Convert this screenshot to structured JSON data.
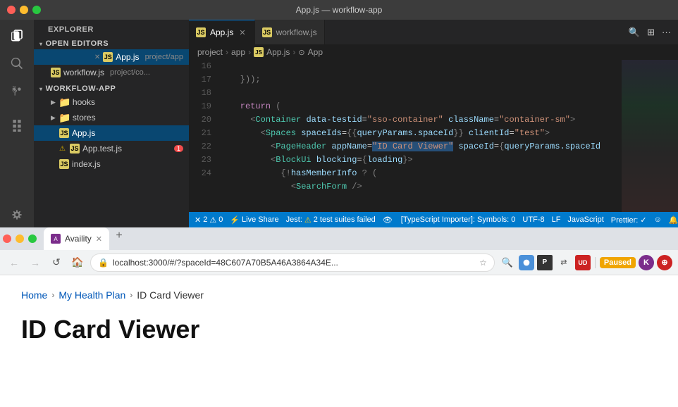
{
  "titlebar": {
    "title": "App.js — workflow-app"
  },
  "vscode": {
    "sidebar": {
      "header": "Explorer",
      "open_editors_label": "Open Editors",
      "workflow_app_label": "WORKFLOW-APP",
      "files": [
        {
          "name": "App.js",
          "sub": "project/app",
          "type": "js",
          "closeable": true
        },
        {
          "name": "workflow.js",
          "sub": "project/co...",
          "type": "js",
          "closeable": false
        }
      ],
      "tree": [
        {
          "name": "hooks",
          "type": "folder",
          "depth": 1
        },
        {
          "name": "stores",
          "type": "folder",
          "depth": 1
        },
        {
          "name": "App.js",
          "type": "js",
          "depth": 2,
          "active": true
        },
        {
          "name": "App.test.js",
          "type": "js",
          "depth": 2,
          "badge": 1,
          "warn": true
        },
        {
          "name": "index.js",
          "type": "js",
          "depth": 2
        }
      ]
    },
    "tabs": [
      {
        "label": "App.js",
        "type": "js",
        "active": true,
        "closeable": true
      },
      {
        "label": "workflow.js",
        "type": "js",
        "active": false,
        "closeable": false
      }
    ],
    "breadcrumb": [
      "project",
      "app",
      "App.js",
      "App"
    ],
    "lines": [
      {
        "num": 16,
        "code": "    }));"
      },
      {
        "num": 17,
        "code": ""
      },
      {
        "num": 18,
        "code": "    return ("
      },
      {
        "num": 19,
        "code": "      <Container data-testid=\"sso-container\" className=\"container-sm\">"
      },
      {
        "num": 20,
        "code": "        <Spaces spaceIds={{queryParams.spaceId}} clientId=\"test\">"
      },
      {
        "num": 21,
        "code": "          <PageHeader appName=\"ID Card Viewer\" spaceId={queryParams.spaceId"
      },
      {
        "num": 22,
        "code": "          <BlockUi blocking={loading}>"
      },
      {
        "num": 23,
        "code": "            {!hasMemberInfo ? ("
      },
      {
        "num": 24,
        "code": "              <SearchForm />"
      }
    ],
    "status": {
      "errors": "2",
      "warnings": "0",
      "live_share": "Live Share",
      "jest": "Jest:",
      "jest_warn": "2 test suites failed",
      "ts_importer": "[TypeScript Importer]: Symbols: 0",
      "encoding": "UTF-8",
      "line_ending": "LF",
      "language": "JavaScript",
      "prettier": "Prettier: ✓",
      "smiley": "☺",
      "bell": "🔔"
    }
  },
  "browser": {
    "tab_label": "Availity",
    "favicon_text": "A",
    "address": "localhost:3000/#/?spaceId=48C607A70B5A46A3864A34E...",
    "paused_label": "Paused",
    "profile_label": "K",
    "breadcrumb": {
      "home": "Home",
      "my_health_plan": "My Health Plan",
      "current": "ID Card Viewer"
    },
    "page_title": "ID Card Viewer"
  }
}
